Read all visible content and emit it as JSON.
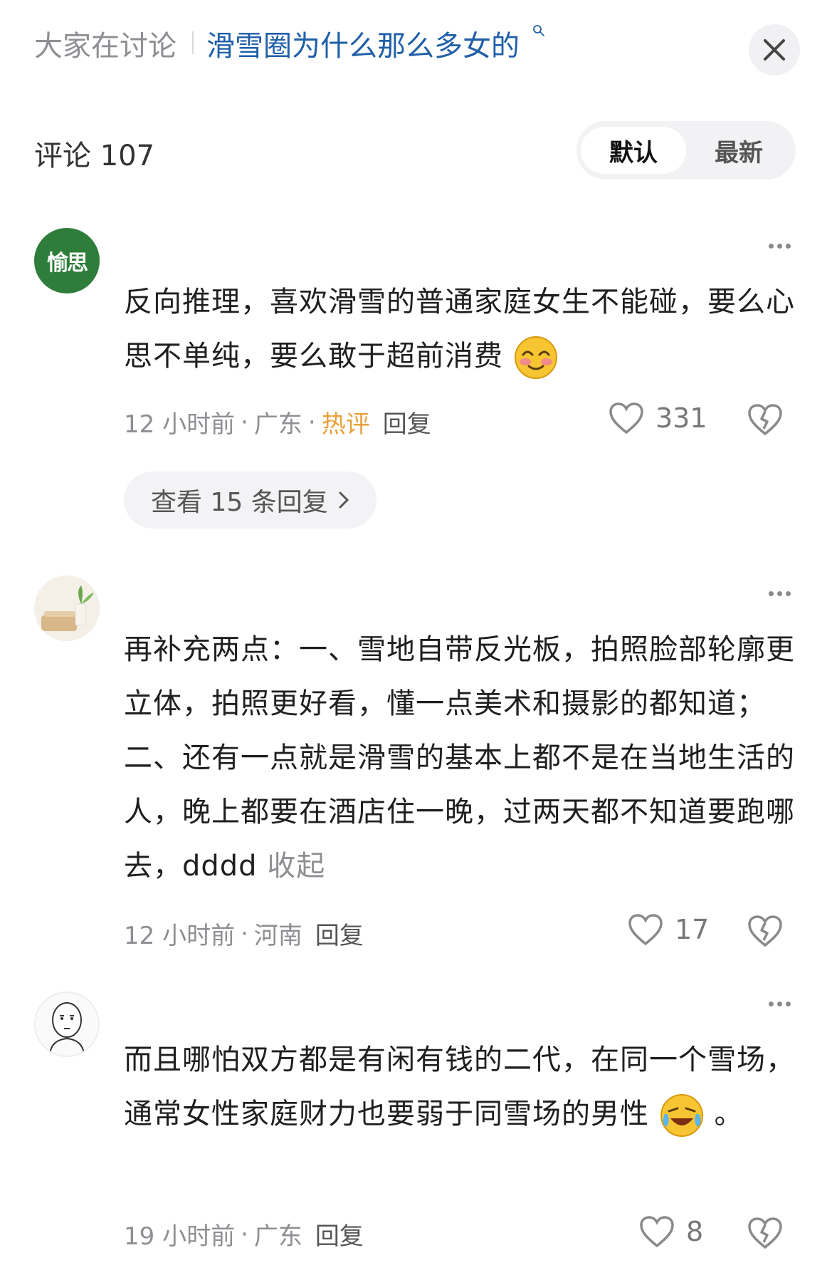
{
  "header": {
    "topic_prefix": "大家在讨论",
    "topic_title": "滑雪圈为什么那么多女的",
    "search_icon": "search-icon",
    "close_icon": "close-icon"
  },
  "comments_header": {
    "label": "评论 107",
    "sort_options": [
      "默认",
      "最新"
    ],
    "active_sort": "默认"
  },
  "comments": [
    {
      "avatar_text": "愉思",
      "avatar_color": "#2e7d3a",
      "text": "反向推理，喜欢滑雪的普通家庭女生不能碰，要么心思不单纯，要么敢于超前消费",
      "emoji": "blushing-smile-emoji",
      "time": "12 小时前",
      "location": "广东",
      "hot_label": "热评",
      "reply_label": "回复",
      "likes": "331",
      "view_replies": "查看 15 条回复"
    },
    {
      "text": "再补充两点：一、雪地自带反光板，拍照脸部轮廓更立体，拍照更好看，懂一点美术和摄影的都知道；二、还有一点就是滑雪的基本上都不是在当地生活的人，晚上都要在酒店住一晚，过两天都不知道要跑哪去，dddd",
      "collapse_label": "收起",
      "time": "12 小时前",
      "location": "河南",
      "reply_label": "回复",
      "likes": "17"
    },
    {
      "text": "而且哪怕双方都是有闲有钱的二代，在同一个雪场，通常女性家庭财力也要弱于同雪场的男性",
      "emoji": "crying-laughing-emoji",
      "text_tail": "。",
      "time": "19 小时前",
      "location": "广东",
      "reply_label": "回复",
      "likes": "8"
    }
  ],
  "meta_separator": "·",
  "colors": {
    "topic_link": "#1f5fa8",
    "hot_label": "#e8a03a",
    "muted": "#8e8e93"
  }
}
